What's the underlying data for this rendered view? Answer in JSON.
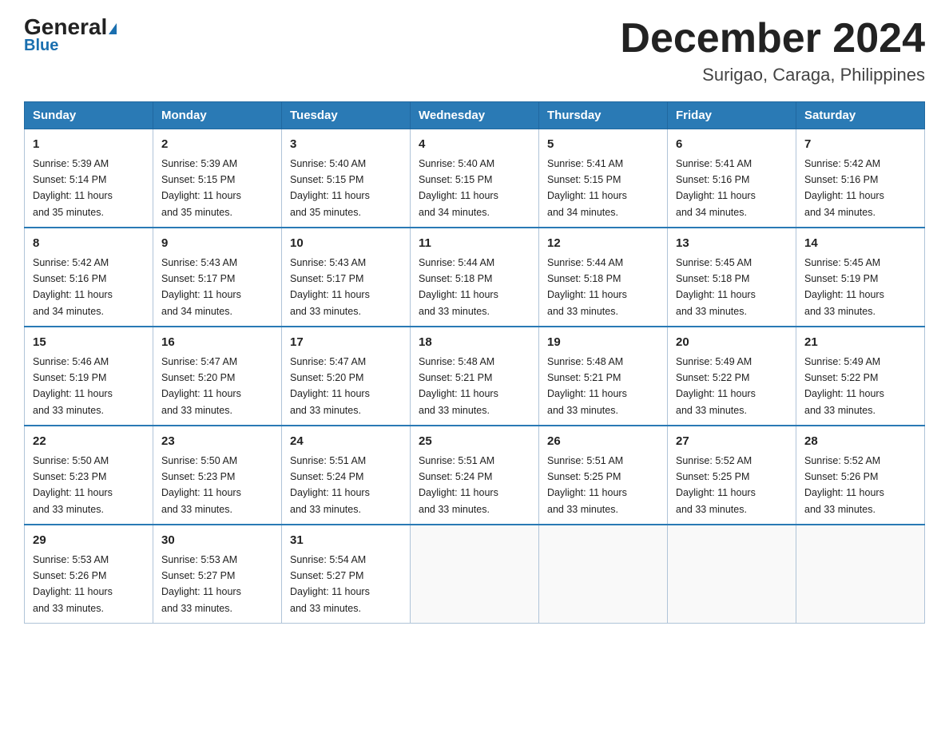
{
  "logo": {
    "general": "General",
    "blue": "Blue"
  },
  "header": {
    "month": "December 2024",
    "location": "Surigao, Caraga, Philippines"
  },
  "days": [
    "Sunday",
    "Monday",
    "Tuesday",
    "Wednesday",
    "Thursday",
    "Friday",
    "Saturday"
  ],
  "weeks": [
    [
      {
        "day": "1",
        "sunrise": "5:39 AM",
        "sunset": "5:14 PM",
        "daylight": "11 hours and 35 minutes."
      },
      {
        "day": "2",
        "sunrise": "5:39 AM",
        "sunset": "5:15 PM",
        "daylight": "11 hours and 35 minutes."
      },
      {
        "day": "3",
        "sunrise": "5:40 AM",
        "sunset": "5:15 PM",
        "daylight": "11 hours and 35 minutes."
      },
      {
        "day": "4",
        "sunrise": "5:40 AM",
        "sunset": "5:15 PM",
        "daylight": "11 hours and 34 minutes."
      },
      {
        "day": "5",
        "sunrise": "5:41 AM",
        "sunset": "5:15 PM",
        "daylight": "11 hours and 34 minutes."
      },
      {
        "day": "6",
        "sunrise": "5:41 AM",
        "sunset": "5:16 PM",
        "daylight": "11 hours and 34 minutes."
      },
      {
        "day": "7",
        "sunrise": "5:42 AM",
        "sunset": "5:16 PM",
        "daylight": "11 hours and 34 minutes."
      }
    ],
    [
      {
        "day": "8",
        "sunrise": "5:42 AM",
        "sunset": "5:16 PM",
        "daylight": "11 hours and 34 minutes."
      },
      {
        "day": "9",
        "sunrise": "5:43 AM",
        "sunset": "5:17 PM",
        "daylight": "11 hours and 34 minutes."
      },
      {
        "day": "10",
        "sunrise": "5:43 AM",
        "sunset": "5:17 PM",
        "daylight": "11 hours and 33 minutes."
      },
      {
        "day": "11",
        "sunrise": "5:44 AM",
        "sunset": "5:18 PM",
        "daylight": "11 hours and 33 minutes."
      },
      {
        "day": "12",
        "sunrise": "5:44 AM",
        "sunset": "5:18 PM",
        "daylight": "11 hours and 33 minutes."
      },
      {
        "day": "13",
        "sunrise": "5:45 AM",
        "sunset": "5:18 PM",
        "daylight": "11 hours and 33 minutes."
      },
      {
        "day": "14",
        "sunrise": "5:45 AM",
        "sunset": "5:19 PM",
        "daylight": "11 hours and 33 minutes."
      }
    ],
    [
      {
        "day": "15",
        "sunrise": "5:46 AM",
        "sunset": "5:19 PM",
        "daylight": "11 hours and 33 minutes."
      },
      {
        "day": "16",
        "sunrise": "5:47 AM",
        "sunset": "5:20 PM",
        "daylight": "11 hours and 33 minutes."
      },
      {
        "day": "17",
        "sunrise": "5:47 AM",
        "sunset": "5:20 PM",
        "daylight": "11 hours and 33 minutes."
      },
      {
        "day": "18",
        "sunrise": "5:48 AM",
        "sunset": "5:21 PM",
        "daylight": "11 hours and 33 minutes."
      },
      {
        "day": "19",
        "sunrise": "5:48 AM",
        "sunset": "5:21 PM",
        "daylight": "11 hours and 33 minutes."
      },
      {
        "day": "20",
        "sunrise": "5:49 AM",
        "sunset": "5:22 PM",
        "daylight": "11 hours and 33 minutes."
      },
      {
        "day": "21",
        "sunrise": "5:49 AM",
        "sunset": "5:22 PM",
        "daylight": "11 hours and 33 minutes."
      }
    ],
    [
      {
        "day": "22",
        "sunrise": "5:50 AM",
        "sunset": "5:23 PM",
        "daylight": "11 hours and 33 minutes."
      },
      {
        "day": "23",
        "sunrise": "5:50 AM",
        "sunset": "5:23 PM",
        "daylight": "11 hours and 33 minutes."
      },
      {
        "day": "24",
        "sunrise": "5:51 AM",
        "sunset": "5:24 PM",
        "daylight": "11 hours and 33 minutes."
      },
      {
        "day": "25",
        "sunrise": "5:51 AM",
        "sunset": "5:24 PM",
        "daylight": "11 hours and 33 minutes."
      },
      {
        "day": "26",
        "sunrise": "5:51 AM",
        "sunset": "5:25 PM",
        "daylight": "11 hours and 33 minutes."
      },
      {
        "day": "27",
        "sunrise": "5:52 AM",
        "sunset": "5:25 PM",
        "daylight": "11 hours and 33 minutes."
      },
      {
        "day": "28",
        "sunrise": "5:52 AM",
        "sunset": "5:26 PM",
        "daylight": "11 hours and 33 minutes."
      }
    ],
    [
      {
        "day": "29",
        "sunrise": "5:53 AM",
        "sunset": "5:26 PM",
        "daylight": "11 hours and 33 minutes."
      },
      {
        "day": "30",
        "sunrise": "5:53 AM",
        "sunset": "5:27 PM",
        "daylight": "11 hours and 33 minutes."
      },
      {
        "day": "31",
        "sunrise": "5:54 AM",
        "sunset": "5:27 PM",
        "daylight": "11 hours and 33 minutes."
      },
      null,
      null,
      null,
      null
    ]
  ],
  "labels": {
    "sunrise": "Sunrise:",
    "sunset": "Sunset:",
    "daylight": "Daylight:"
  }
}
